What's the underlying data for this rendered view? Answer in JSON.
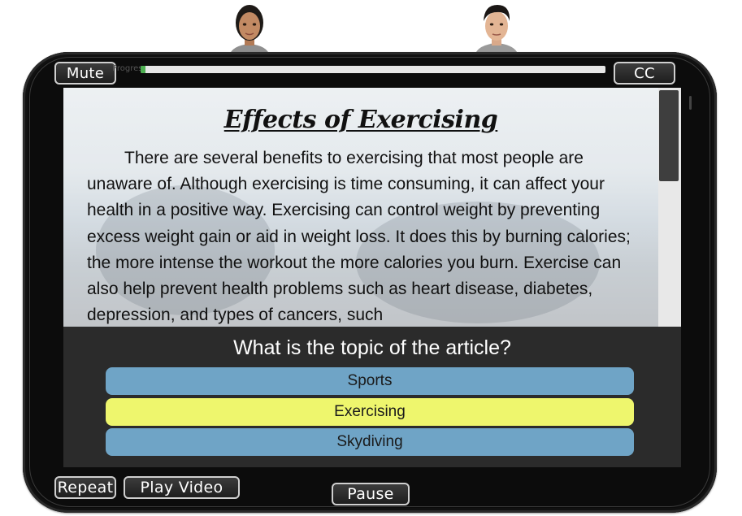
{
  "controls": {
    "mute_label": "Mute",
    "cc_label": "CC",
    "repeat_label": "Repeat",
    "play_video_label": "Play Video",
    "pause_label": "Pause"
  },
  "progress": {
    "label": "Progress",
    "value_fraction": 0.01
  },
  "article": {
    "title": "Effects of Exercising",
    "body": "There are several benefits to exercising that most people are unaware of. Although exercising is time consuming, it can affect your health in a positive way. Exercising can control weight by preventing excess weight gain or aid in weight loss. It does this by burning calories; the more intense the workout the more calories you burn. Exercise can also help prevent health problems such as heart disease, diabetes, depression, and types of cancers, such"
  },
  "quiz": {
    "question": "What is the topic of the article?",
    "answers": [
      {
        "label": "Sports",
        "color": "#6fa4c6"
      },
      {
        "label": "Exercising",
        "color": "#eef66d"
      },
      {
        "label": "Skydiving",
        "color": "#6fa4c6"
      }
    ]
  },
  "colors": {
    "tablet_frame": "#0c0c0c",
    "panel": "#2b2b2b",
    "answer_default": "#6fa4c6",
    "answer_selected": "#eef66d",
    "progress_fill": "#4caf50"
  }
}
